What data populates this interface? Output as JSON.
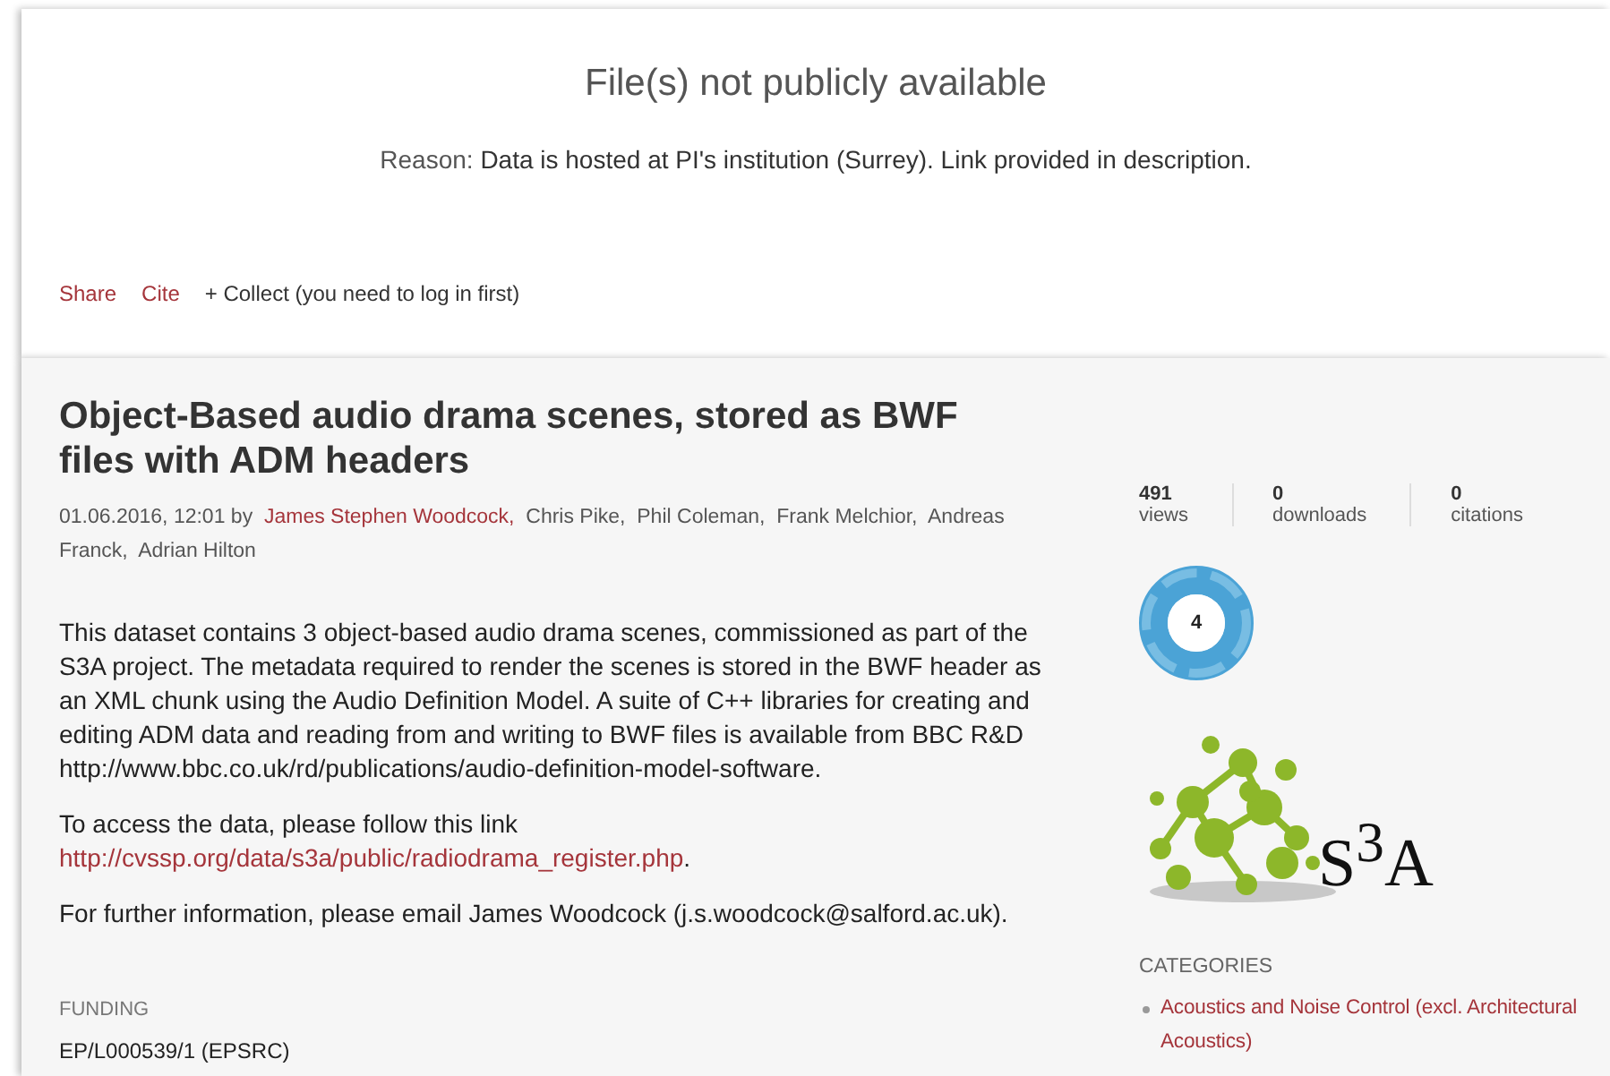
{
  "notice": {
    "title": "File(s) not publicly available",
    "reason_label": "Reason:",
    "reason": "Data is hosted at PI's institution (Surrey). Link provided in description."
  },
  "actions": [
    {
      "label": "Share",
      "kind": "link"
    },
    {
      "label": "Cite",
      "kind": "link"
    },
    {
      "label": "+ Collect (you need to log in first)",
      "kind": "plain"
    }
  ],
  "item": {
    "title": "Object-Based audio drama scenes, stored as BWF files with ADM headers",
    "date": "01.06.2016, 12:01 by",
    "authors": [
      {
        "name": "James Stephen Woodcock,",
        "linked": true
      },
      {
        "name": "Chris Pike,",
        "linked": false
      },
      {
        "name": "Phil Coleman,",
        "linked": false
      },
      {
        "name": "Frank Melchior,",
        "linked": false
      },
      {
        "name": "Andreas Franck,",
        "linked": false
      },
      {
        "name": "Adrian Hilton",
        "linked": false
      }
    ],
    "description": "This dataset contains 3 object-based audio drama scenes, commissioned as part of the S3A project. The metadata required to render the scenes is stored in the BWF header as an XML chunk using the Audio Definition Model. A suite of C++ libraries for creating and editing ADM data and reading from and writing to BWF files is available from BBC R&D http://www.bbc.co.uk/rd/publications/audio-definition-model-software.",
    "access_text": "To access the data, please follow this link",
    "access_link": "http://cvssp.org/data/s3a/public/radiodrama_register.php",
    "access_end": ".",
    "contact": "For further information, please email James Woodcock (j.s.woodcock@salford.ac.uk).",
    "funding_heading": "FUNDING",
    "funding": "EP/L000539/1 (EPSRC)"
  },
  "stats": [
    {
      "value": "491",
      "label": "views"
    },
    {
      "value": "0",
      "label": "downloads"
    },
    {
      "value": "0",
      "label": "citations"
    }
  ],
  "altmetric_score": "4",
  "logo_text": "S$^{3}$A",
  "categories_heading": "CATEGORIES",
  "categories": [
    "Acoustics and Noise Control (excl. Architectural Acoustics)"
  ]
}
